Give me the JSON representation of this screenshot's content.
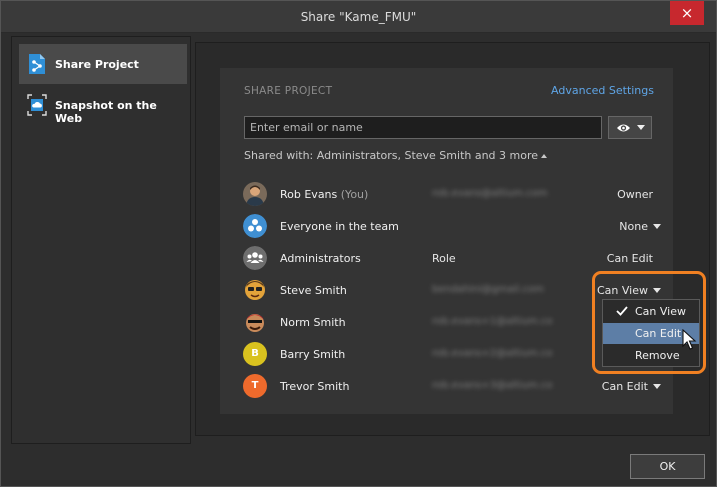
{
  "window": {
    "title": "Share \"Kame_FMU\"",
    "close_icon": "×"
  },
  "sidebar": {
    "items": [
      {
        "label": "Share Project",
        "icon": "share-icon",
        "active": true
      },
      {
        "label": "Snapshot on the Web",
        "icon": "cloud-snapshot-icon",
        "active": false
      }
    ]
  },
  "share": {
    "section_title": "SHARE PROJECT",
    "advanced_link": "Advanced Settings",
    "email_placeholder": "Enter email or name",
    "visibility_icon": "eye-icon",
    "shared_with": "Shared with: Administrators, Steve Smith and 3 more"
  },
  "members": [
    {
      "name": "Rob Evans",
      "suffix": "(You)",
      "email": "rob.evans@altium.com",
      "permission": "Owner",
      "has_dropdown": false
    },
    {
      "name": "Everyone in the team",
      "suffix": "",
      "email": "",
      "permission": "None",
      "has_dropdown": true
    },
    {
      "name": "Administrators",
      "suffix": "",
      "role_label": "Role",
      "permission": "Can Edit",
      "has_dropdown": false
    },
    {
      "name": "Steve Smith",
      "suffix": "",
      "email": "bendahini@gmail.com",
      "permission": "Can View",
      "has_dropdown": true
    },
    {
      "name": "Norm Smith",
      "suffix": "",
      "email": "rob.evans+1@altium.com",
      "permission": "",
      "has_dropdown": false
    },
    {
      "name": "Barry Smith",
      "suffix": "",
      "avatar_letter": "B",
      "email": "rob.evans+2@altium.com",
      "permission": "",
      "has_dropdown": false
    },
    {
      "name": "Trevor Smith",
      "suffix": "",
      "avatar_letter": "T",
      "email": "rob.evans+3@altium.com",
      "permission": "Can Edit",
      "has_dropdown": true
    }
  ],
  "permission_menu": {
    "items": [
      {
        "label": "Can View",
        "checked": true
      },
      {
        "label": "Can Edit",
        "hovered": true
      },
      {
        "label": "Remove"
      }
    ]
  },
  "footer": {
    "ok_label": "OK"
  },
  "colors": {
    "accent_link": "#5fa5e6",
    "highlight": "#f08022",
    "menu_hover": "#5d7ea6",
    "close": "#c7282e"
  }
}
